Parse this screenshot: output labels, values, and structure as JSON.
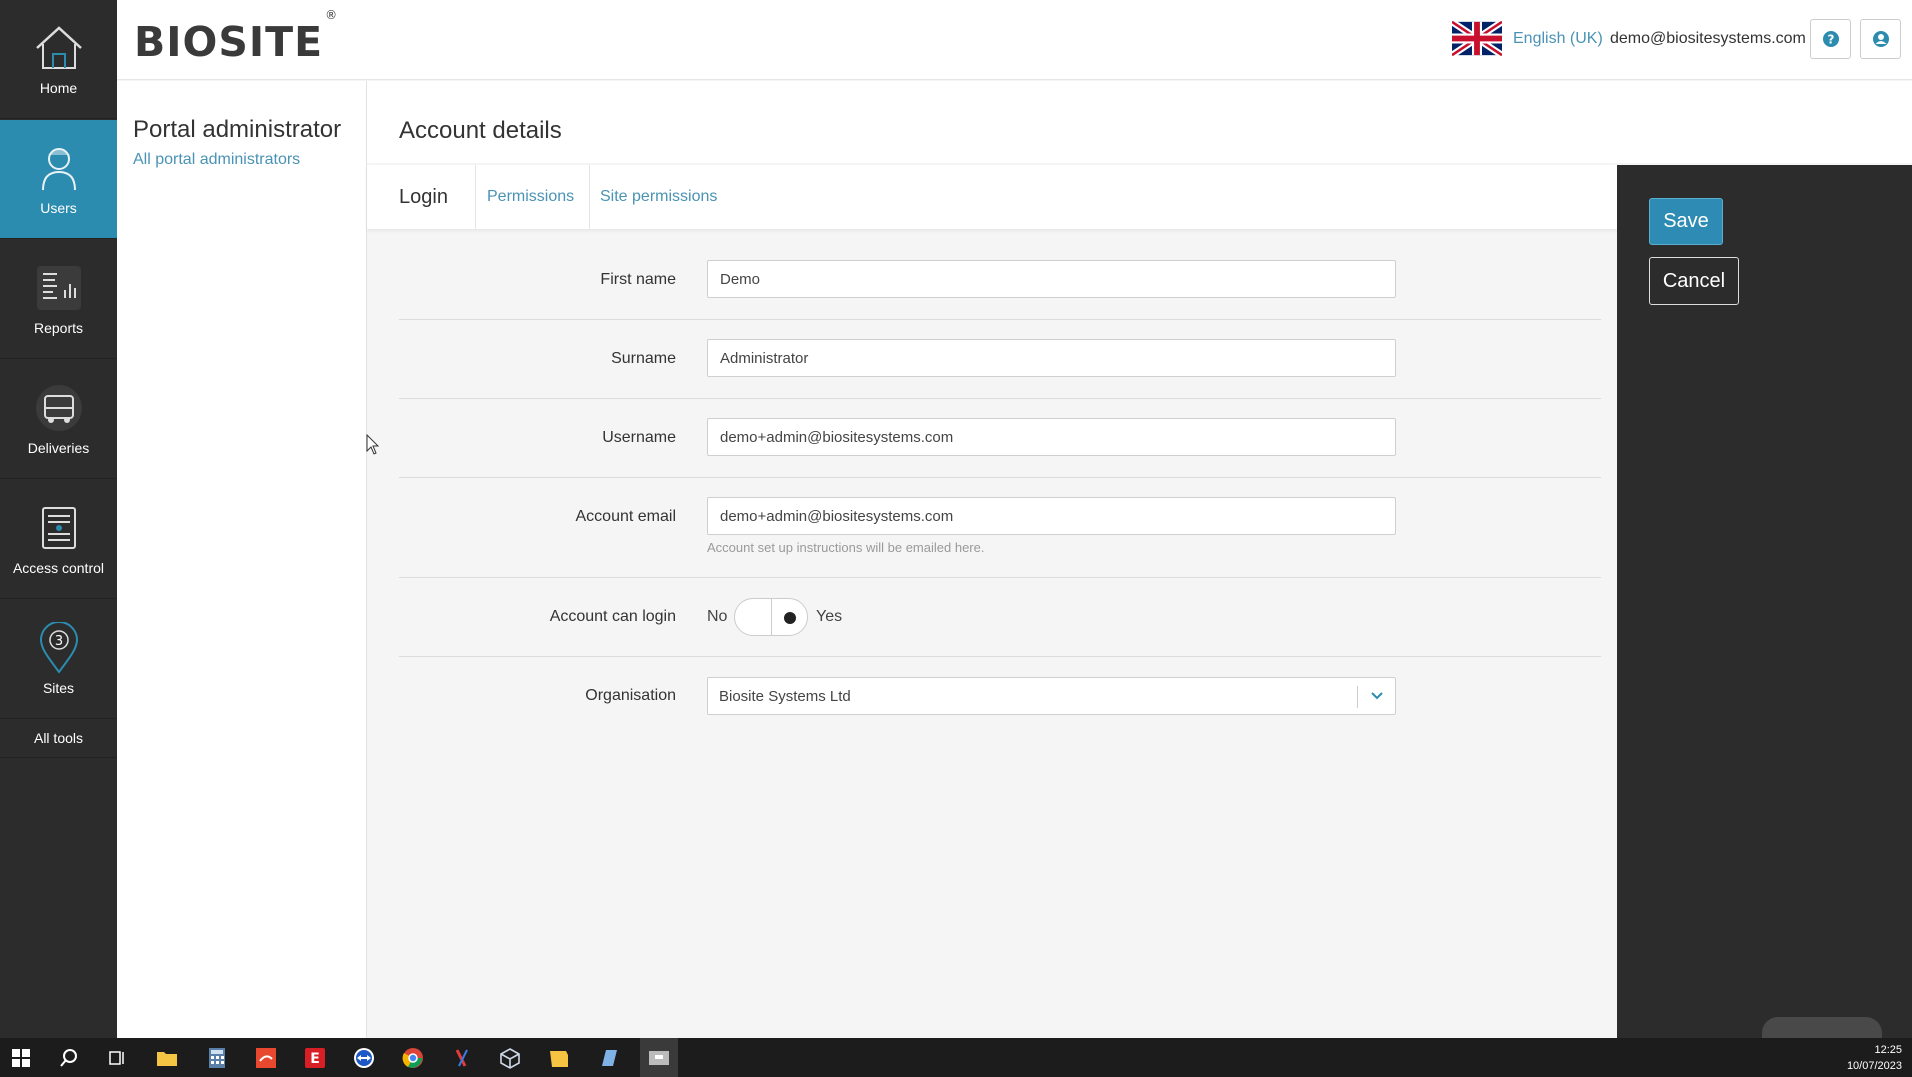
{
  "nav": {
    "items": [
      {
        "label": "Home",
        "icon": "home-icon"
      },
      {
        "label": "Users",
        "icon": "users-icon"
      },
      {
        "label": "Reports",
        "icon": "reports-icon"
      },
      {
        "label": "Deliveries",
        "icon": "deliveries-icon"
      },
      {
        "label": "Access control",
        "icon": "access-control-icon"
      },
      {
        "label": "Sites",
        "icon": "sites-icon",
        "badge": "3"
      }
    ],
    "all_tools": "All tools"
  },
  "header": {
    "logo": "BIOSITE",
    "logo_mark": "®",
    "language": "English (UK)",
    "user_email": "demo@biositesystems.com"
  },
  "subpanel": {
    "title": "Portal administrator",
    "link": "All portal administrators"
  },
  "main": {
    "title": "Account details",
    "tabs": [
      {
        "label": "Login",
        "active": true
      },
      {
        "label": "Permissions",
        "active": false
      },
      {
        "label": "Site permissions",
        "active": false
      }
    ]
  },
  "form": {
    "first_name": {
      "label": "First name",
      "value": "Demo"
    },
    "surname": {
      "label": "Surname",
      "value": "Administrator"
    },
    "username": {
      "label": "Username",
      "value": "demo+admin@biositesystems.com"
    },
    "account_email": {
      "label": "Account email",
      "value": "demo+admin@biositesystems.com",
      "hint": "Account set up instructions will be emailed here."
    },
    "can_login": {
      "label": "Account can login",
      "no": "No",
      "yes": "Yes",
      "value": "Yes"
    },
    "organisation": {
      "label": "Organisation",
      "value": "Biosite Systems Ltd"
    }
  },
  "actions": {
    "save": "Save",
    "cancel": "Cancel"
  },
  "taskbar": {
    "time": "12:25",
    "date": "10/07/2023"
  },
  "colors": {
    "accent": "#2b8cb0",
    "link": "#4a93b4",
    "dark_panel": "#2b2c2b"
  }
}
